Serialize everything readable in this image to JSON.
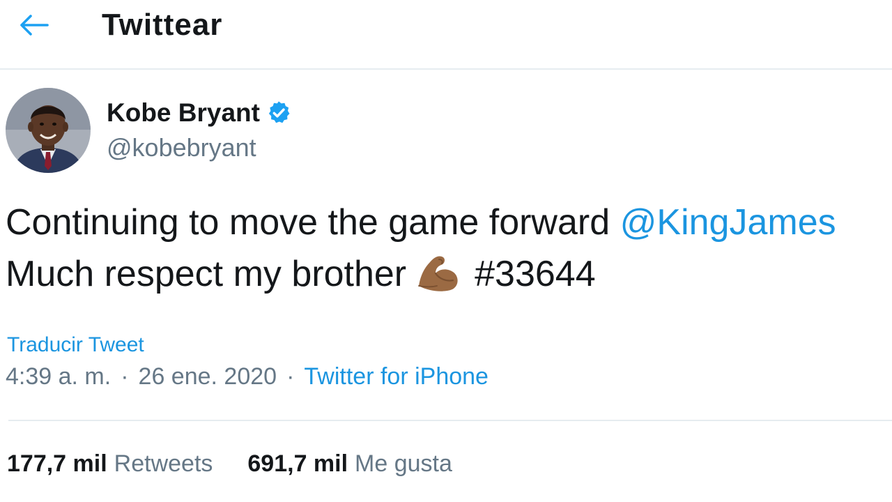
{
  "header": {
    "title": "Twittear",
    "back_icon": "arrow-left-icon",
    "accent_color": "#1da1f2"
  },
  "author": {
    "name": "Kobe Bryant",
    "handle": "@kobebryant",
    "verified": true,
    "verified_icon": "verified-badge-icon"
  },
  "tweet": {
    "line1_text": "Continuing to move the game forward ",
    "mention": "@KingJames",
    "line2_text": "Much respect my brother",
    "emoji": "flexed-biceps-icon",
    "hashtag": "#33644"
  },
  "translate_label": "Traducir Tweet",
  "meta": {
    "time": "4:39 a. m.",
    "separator": "·",
    "date": "26 ene. 2020",
    "source": "Twitter for iPhone"
  },
  "stats": {
    "retweets_count": "177,7 mil",
    "retweets_label": "Retweets",
    "likes_count": "691,7 mil",
    "likes_label": "Me gusta"
  },
  "colors": {
    "link": "#1b95e0",
    "muted": "#657786",
    "text": "#14171a",
    "border": "#e6ecf0"
  }
}
